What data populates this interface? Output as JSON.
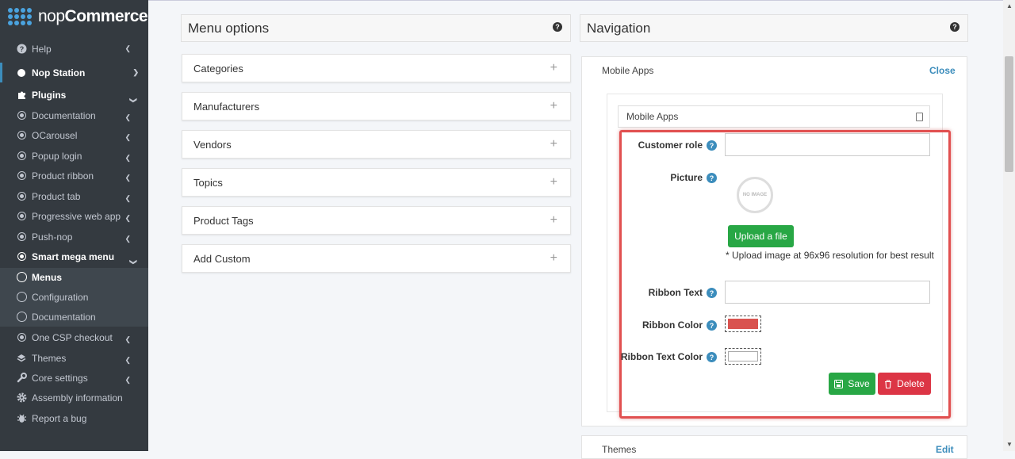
{
  "brand": {
    "name_light": "nop",
    "name_bold": "Commerce"
  },
  "sidebar": {
    "items": [
      {
        "label": "Help",
        "icon": "question-circle-icon"
      },
      {
        "label": "Nop Station",
        "icon": "dot-icon"
      },
      {
        "label": "Plugins",
        "icon": "puzzle-icon"
      },
      {
        "label": "Documentation",
        "icon": "circle-dot-icon"
      },
      {
        "label": "OCarousel",
        "icon": "circle-dot-icon"
      },
      {
        "label": "Popup login",
        "icon": "circle-dot-icon"
      },
      {
        "label": "Product ribbon",
        "icon": "circle-dot-icon"
      },
      {
        "label": "Product tab",
        "icon": "circle-dot-icon"
      },
      {
        "label": "Progressive web app",
        "icon": "circle-dot-icon"
      },
      {
        "label": "Push-nop",
        "icon": "circle-dot-icon"
      },
      {
        "label": "Smart mega menu",
        "icon": "circle-dot-icon"
      },
      {
        "label": "Menus",
        "icon": "circle-icon"
      },
      {
        "label": "Configuration",
        "icon": "circle-icon"
      },
      {
        "label": "Documentation",
        "icon": "circle-icon"
      },
      {
        "label": "One CSP checkout",
        "icon": "circle-dot-icon"
      },
      {
        "label": "Themes",
        "icon": "layers-icon"
      },
      {
        "label": "Core settings",
        "icon": "wrench-icon"
      },
      {
        "label": "Assembly information",
        "icon": "gear-icon"
      },
      {
        "label": "Report a bug",
        "icon": "bug-icon"
      }
    ]
  },
  "menu_options": {
    "title": "Menu options",
    "sections": [
      "Categories",
      "Manufacturers",
      "Vendors",
      "Topics",
      "Product Tags",
      "Add Custom"
    ]
  },
  "navigation": {
    "title": "Navigation",
    "panel_title": "Mobile Apps",
    "close_label": "Close",
    "item_header": "Mobile Apps",
    "form": {
      "customer_role_label": "Customer role",
      "customer_role_value": "",
      "picture_label": "Picture",
      "no_image_text": "NO IMAGE",
      "upload_label": "Upload a file",
      "upload_hint": "* Upload image at 96x96 resolution for best result",
      "ribbon_text_label": "Ribbon Text",
      "ribbon_text_value": "",
      "ribbon_color_label": "Ribbon Color",
      "ribbon_color": "#d9534f",
      "ribbon_text_color_label": "Ribbon Text Color",
      "ribbon_text_color": "#ffffff",
      "save_label": "Save",
      "delete_label": "Delete"
    },
    "next_panel_title": "Themes",
    "next_panel_action": "Edit"
  },
  "colors": {
    "accent": "#3c8dbc",
    "success": "#28a745",
    "danger": "#dc3545",
    "highlight": "#e15050"
  }
}
